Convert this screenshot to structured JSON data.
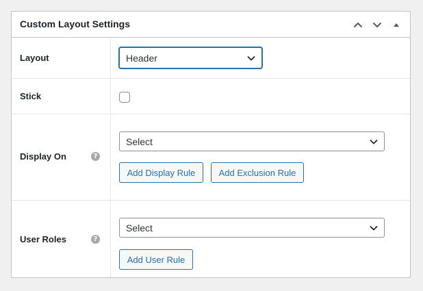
{
  "metabox": {
    "title": "Custom Layout Settings",
    "controls": {
      "move_up_icon": "chevron-up-icon",
      "move_down_icon": "chevron-down-icon",
      "toggle_icon": "triangle-up-icon"
    }
  },
  "fields": {
    "layout": {
      "label": "Layout",
      "value": "Header"
    },
    "stick": {
      "label": "Stick",
      "checked": false
    },
    "display_on": {
      "label": "Display On",
      "help": "?",
      "select_value": "Select",
      "add_display_rule": "Add Display Rule",
      "add_exclusion_rule": "Add Exclusion Rule"
    },
    "user_roles": {
      "label": "User Roles",
      "help": "?",
      "select_value": "Select",
      "add_user_rule": "Add User Rule"
    }
  },
  "colors": {
    "accent": "#2271b1",
    "border": "#c3c4c7",
    "background": "#f0f0f1"
  }
}
